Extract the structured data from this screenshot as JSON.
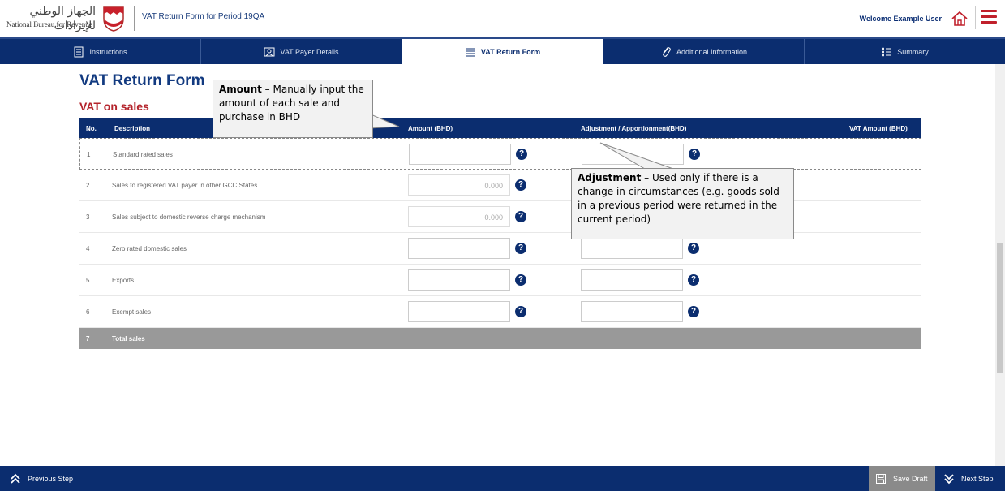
{
  "header": {
    "logo_arabic": "الجهاز الوطني للإيرادات",
    "logo_english": "National Bureau for Revenue",
    "title": "VAT Return Form for Period 19QA",
    "welcome": "Welcome Example User"
  },
  "tabs": [
    {
      "label": "Instructions",
      "icon": "document-icon",
      "active": false
    },
    {
      "label": "VAT Payer Details",
      "icon": "person-card-icon",
      "active": false
    },
    {
      "label": "VAT Return Form",
      "icon": "list-icon",
      "active": true
    },
    {
      "label": "Additional Information",
      "icon": "paperclip-icon",
      "active": false
    },
    {
      "label": "Summary",
      "icon": "checklist-icon",
      "active": false
    }
  ],
  "main": {
    "page_title": "VAT Return Form",
    "section_title": "VAT on sales",
    "columns": {
      "no": "No.",
      "description": "Description",
      "amount": "Amount (BHD)",
      "adjustment": "Adjustment / Apportionment(BHD)",
      "vat_amount": "VAT Amount (BHD)"
    },
    "rows": [
      {
        "no": "1",
        "description": "Standard rated sales",
        "amount": "",
        "adjustment": ""
      },
      {
        "no": "2",
        "description": "Sales to registered VAT payer in other GCC States",
        "amount": "0.000",
        "adjustment": ""
      },
      {
        "no": "3",
        "description": "Sales subject to domestic reverse charge mechanism",
        "amount": "0.000",
        "adjustment": ""
      },
      {
        "no": "4",
        "description": "Zero rated domestic sales",
        "amount": "",
        "adjustment": ""
      },
      {
        "no": "5",
        "description": "Exports",
        "amount": "",
        "adjustment": ""
      },
      {
        "no": "6",
        "description": "Exempt sales",
        "amount": "",
        "adjustment": ""
      }
    ],
    "total": {
      "no": "7",
      "description": "Total sales"
    },
    "help_glyph": "?"
  },
  "callouts": {
    "amount": {
      "title": "Amount",
      "text": " – Manually input the amount of each sale and purchase in BHD"
    },
    "adjustment": {
      "title": "Adjustment",
      "text": " – Used only if there is a change in circumstances (e.g. goods sold in a previous period were returned in the current period)"
    }
  },
  "footer": {
    "previous": "Previous Step",
    "save": "Save Draft",
    "next": "Next Step"
  },
  "colors": {
    "navy": "#0b2d6f",
    "section_red": "#b4232b",
    "total_gray": "#999999"
  }
}
